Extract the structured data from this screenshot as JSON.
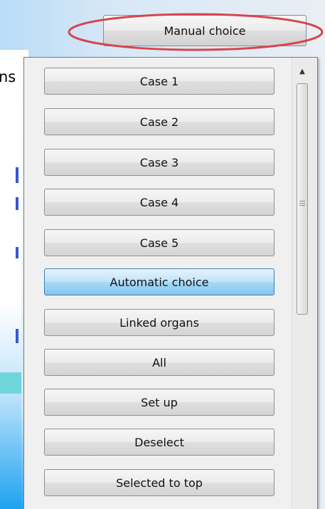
{
  "background": {
    "text_fragment": "ns"
  },
  "trigger": {
    "label": "Manual choice"
  },
  "options": [
    {
      "label": "Case 1",
      "selected": false
    },
    {
      "label": "Case 2",
      "selected": false
    },
    {
      "label": "Case 3",
      "selected": false
    },
    {
      "label": "Case 4",
      "selected": false
    },
    {
      "label": "Case 5",
      "selected": false
    },
    {
      "label": "Automatic choice",
      "selected": true
    },
    {
      "label": "Linked organs",
      "selected": false
    },
    {
      "label": "All",
      "selected": false
    },
    {
      "label": "Set up",
      "selected": false
    },
    {
      "label": "Deselect",
      "selected": false
    },
    {
      "label": "Selected to top",
      "selected": false
    }
  ],
  "colors": {
    "highlight_ellipse": "#d9434f",
    "selected_option": "#a7d8f5"
  }
}
